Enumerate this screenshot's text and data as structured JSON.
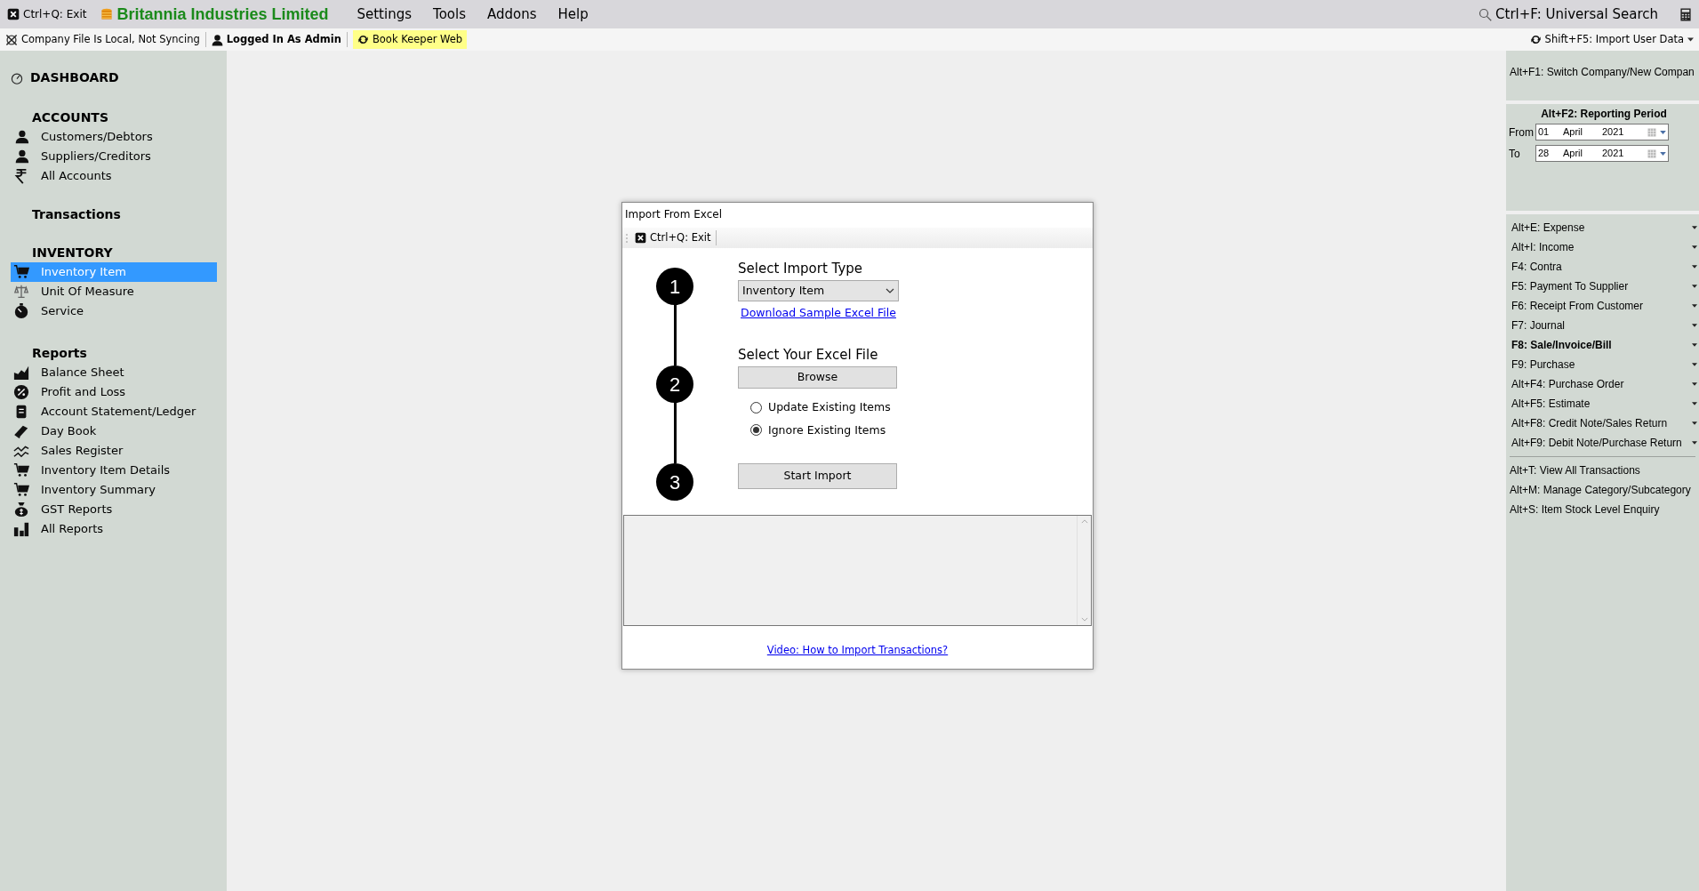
{
  "topbar": {
    "exit": "Ctrl+Q: Exit",
    "company": "Britannia Industries Limited",
    "menus": [
      "Settings",
      "Tools",
      "Addons",
      "Help"
    ],
    "search": "Ctrl+F: Universal Search"
  },
  "statusbar": {
    "sync_status": "Company File Is Local, Not Syncing",
    "user": "Logged In As Admin",
    "web": "Book Keeper Web",
    "import": "Shift+F5: Import User Data"
  },
  "sidebar": {
    "dashboard": "DASHBOARD",
    "sections": [
      {
        "title": "ACCOUNTS",
        "items": [
          {
            "label": "Customers/Debtors",
            "selected": false
          },
          {
            "label": "Suppliers/Creditors",
            "selected": false
          },
          {
            "label": "All Accounts",
            "selected": false
          }
        ]
      },
      {
        "title": "Transactions"
      },
      {
        "title": "INVENTORY",
        "items": [
          {
            "label": "Inventory Item",
            "selected": true
          },
          {
            "label": "Unit Of Measure",
            "selected": false
          },
          {
            "label": "Service",
            "selected": false
          }
        ]
      },
      {
        "title": "Reports",
        "items": [
          {
            "label": "Balance Sheet",
            "selected": false
          },
          {
            "label": "Profit and Loss",
            "selected": false
          },
          {
            "label": "Account Statement/Ledger",
            "selected": false
          },
          {
            "label": "Day Book",
            "selected": false
          },
          {
            "label": "Sales Register",
            "selected": false
          },
          {
            "label": "Inventory Item Details",
            "selected": false
          },
          {
            "label": "Inventory Summary",
            "selected": false
          },
          {
            "label": "GST Reports",
            "selected": false
          },
          {
            "label": "All Reports",
            "selected": false
          }
        ]
      }
    ]
  },
  "dialog": {
    "title": "Import From Excel",
    "toolbar_exit": "Ctrl+Q: Exit",
    "steps": [
      "1",
      "2",
      "3"
    ],
    "import_type_heading": "Select Import Type",
    "import_type": "Inventory Item",
    "sample_link": "Download Sample Excel File",
    "file_heading": "Select Your Excel File",
    "browse": "Browse",
    "options": [
      {
        "label": "Update Existing Items",
        "selected": false
      },
      {
        "label": "Ignore Existing Items",
        "selected": true
      }
    ],
    "start": "Start Import",
    "video_link": "Video: How to Import Transactions?"
  },
  "right_panel": {
    "switch_company": "Alt+F1: Switch Company/New Compan",
    "period": {
      "title": "Alt+F2: Reporting Period",
      "rows": [
        {
          "label": "From",
          "day": "01",
          "month": "April",
          "year": "2021"
        },
        {
          "label": "To",
          "day": "28",
          "month": "April",
          "year": "2021"
        }
      ]
    },
    "actions": [
      {
        "label": "Alt+E: Expense",
        "bold": false
      },
      {
        "label": "Alt+I: Income",
        "bold": false
      },
      {
        "label": "F4: Contra",
        "bold": false
      },
      {
        "label": "F5: Payment To Supplier",
        "bold": false
      },
      {
        "label": "F6: Receipt From Customer",
        "bold": false
      },
      {
        "label": "F7: Journal",
        "bold": false
      },
      {
        "label": "F8: Sale/Invoice/Bill",
        "bold": true
      },
      {
        "label": "F9: Purchase",
        "bold": false
      },
      {
        "label": "Alt+F4: Purchase Order",
        "bold": false
      },
      {
        "label": "Alt+F5: Estimate",
        "bold": false
      },
      {
        "label": "Alt+F8: Credit Note/Sales Return",
        "bold": false
      },
      {
        "label": "Alt+F9: Debit Note/Purchase Return",
        "bold": false
      }
    ],
    "links": [
      "Alt+T: View All Transactions",
      "Alt+M: Manage Category/Subcategory",
      "Alt+S: Item Stock Level Enquiry"
    ]
  }
}
